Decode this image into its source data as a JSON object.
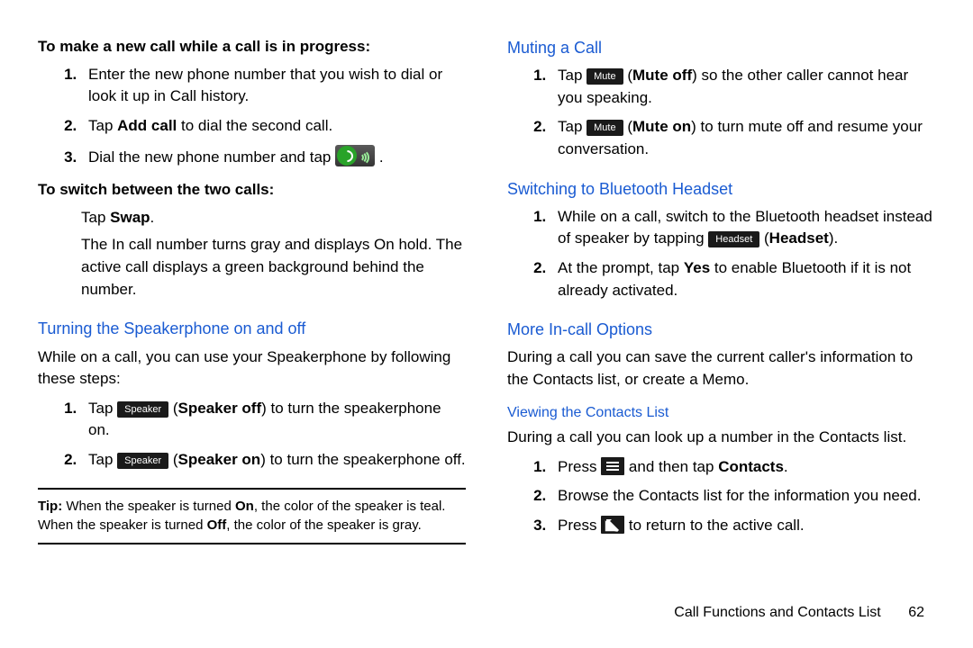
{
  "left": {
    "h1": "To make a new call while a call is in progress:",
    "list1": {
      "i1": "Enter the new phone number that you wish to dial or look it up in Call history.",
      "i2a": "Tap ",
      "i2b": "Add call",
      "i2c": " to dial the second call.",
      "i3a": "Dial the new phone number and tap ",
      "i3p": "."
    },
    "h2": "To switch between the two calls:",
    "swap_a": "Tap ",
    "swap_b": "Swap",
    "swap_c": ".",
    "swap_desc": "The In call number turns gray and displays On hold. The active call displays a green background behind the number.",
    "speaker_h": "Turning the Speakerphone on and off",
    "speaker_intro": "While on a call, you can use your Speakerphone by following these steps:",
    "sp_list": {
      "i1a": "Tap ",
      "i1btn": "Speaker",
      "i1b": " (",
      "i1bold": "Speaker off",
      "i1c": ") to turn the speakerphone on.",
      "i2a": "Tap ",
      "i2btn": "Speaker",
      "i2b": " (",
      "i2bold": "Speaker on",
      "i2c": ") to turn the speakerphone off."
    },
    "tip": {
      "label": "Tip:",
      "a": " When the speaker is turned ",
      "on": "On",
      "b": ", the color of the speaker is teal. When the speaker is turned ",
      "off": "Off",
      "c": ", the color of the speaker is gray."
    }
  },
  "right": {
    "mute_h": "Muting a Call",
    "mute_list": {
      "i1a": "Tap ",
      "i1btn": "Mute",
      "i1b": " (",
      "i1bold": "Mute off",
      "i1c": ") so the other caller cannot hear you speaking.",
      "i2a": "Tap ",
      "i2btn": "Mute",
      "i2b": " (",
      "i2bold": "Mute on",
      "i2c": ") to turn mute off and resume your conversation."
    },
    "bt_h": "Switching to Bluetooth Headset",
    "bt_list": {
      "i1a": "While on a call, switch to the Bluetooth headset instead of speaker by tapping ",
      "i1btn": "Headset",
      "i1b": " (",
      "i1bold": "Headset",
      "i1c": ").",
      "i2a": "At the prompt, tap ",
      "i2bold": "Yes",
      "i2b": " to enable Bluetooth if it is not already activated."
    },
    "more_h": "More In-call Options",
    "more_p": "During a call you can save the current caller's information to the Contacts list, or create a Memo.",
    "view_h": "Viewing the Contacts List",
    "view_p": "During a call you can look up a number in the Contacts list.",
    "view_list": {
      "i1a": "Press ",
      "i1b": " and then tap ",
      "i1bold": "Contacts",
      "i1c": ".",
      "i2": "Browse the Contacts list for the information you need.",
      "i3a": "Press ",
      "i3b": " to return to the active call."
    }
  },
  "footer": {
    "section": "Call Functions and Contacts List",
    "page": "62"
  }
}
